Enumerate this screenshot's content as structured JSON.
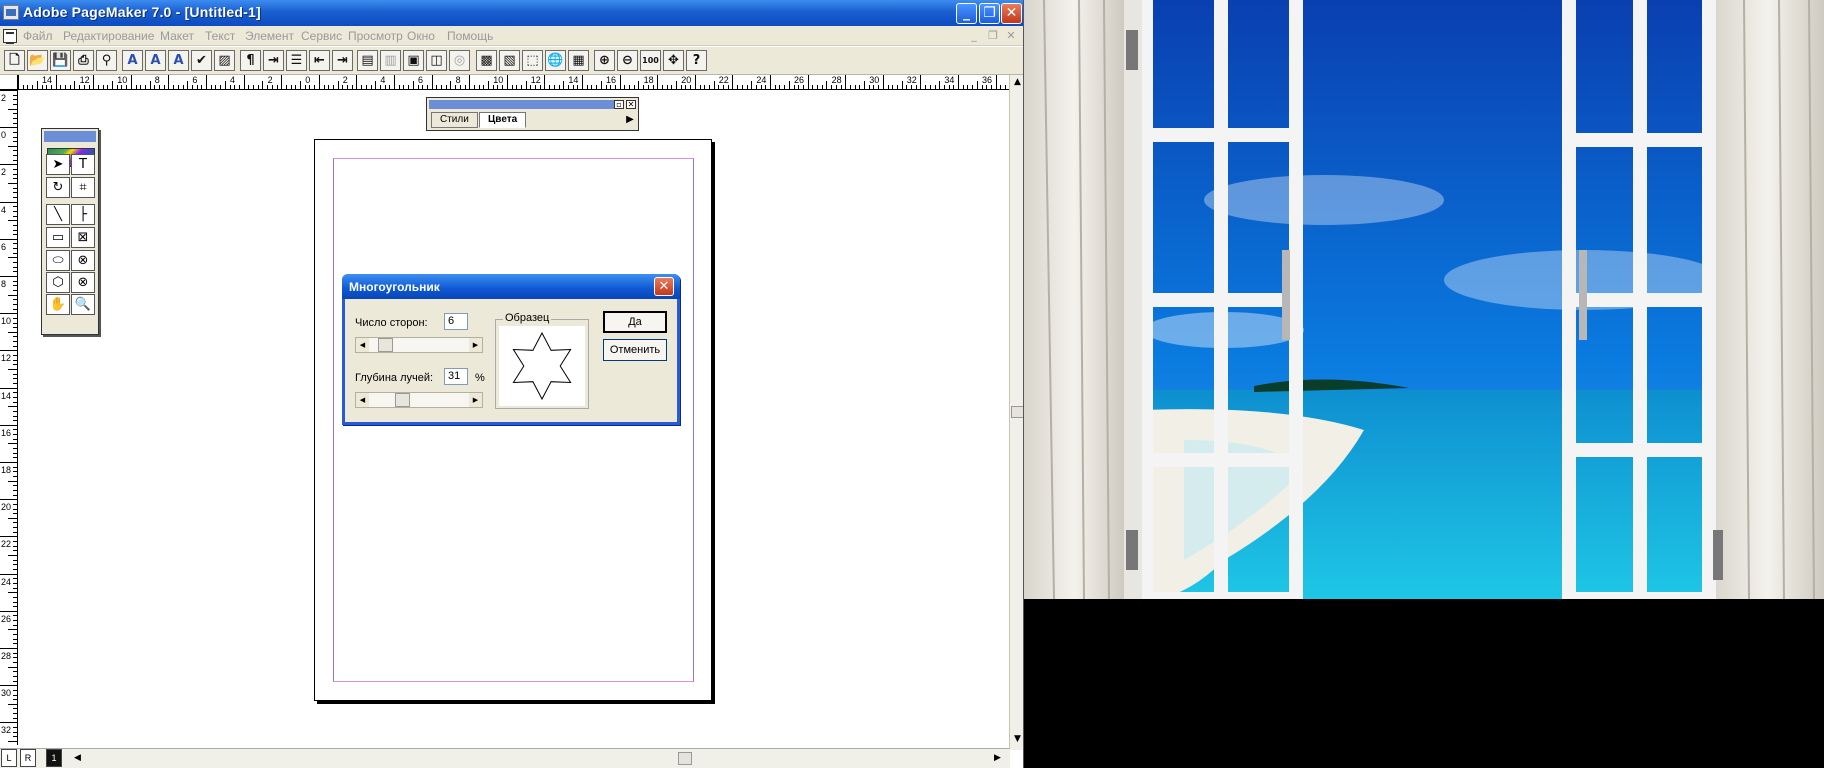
{
  "window": {
    "title": "Adobe PageMaker 7.0 - [Untitled-1]",
    "minimize": "_",
    "restore": "❐",
    "close": "✕"
  },
  "menu": {
    "items": [
      "Файл",
      "Редактирование",
      "Макет",
      "Текст",
      "Элемент",
      "Сервис",
      "Просмотр",
      "Окно",
      "Помощь"
    ],
    "doc_minimize": "_",
    "doc_restore": "❐",
    "doc_close": "✕"
  },
  "toolbar": {
    "buttons": [
      {
        "icon": "new-document-icon",
        "glyph": "🗋"
      },
      {
        "icon": "open-folder-icon",
        "glyph": "📂"
      },
      {
        "icon": "save-icon",
        "glyph": "💾"
      },
      {
        "icon": "print-icon",
        "glyph": "⎙"
      },
      {
        "icon": "find-icon",
        "glyph": "⚲"
      },
      {
        "icon": "character-format-icon",
        "glyph": "A"
      },
      {
        "icon": "font-size-up-icon",
        "glyph": "A"
      },
      {
        "icon": "font-size-down-icon",
        "glyph": "A"
      },
      {
        "icon": "spell-check-icon",
        "glyph": "✔"
      },
      {
        "icon": "fill-icon",
        "glyph": "▨"
      },
      {
        "icon": "paragraph-icon",
        "glyph": "¶"
      },
      {
        "icon": "indents-icon",
        "glyph": "⇥"
      },
      {
        "icon": "bullets-icon",
        "glyph": "☰"
      },
      {
        "icon": "decrease-indent-icon",
        "glyph": "⇤"
      },
      {
        "icon": "increase-indent-icon",
        "glyph": "⇥"
      },
      {
        "icon": "styles-icon",
        "glyph": "▤"
      },
      {
        "icon": "colors-icon",
        "glyph": "▥"
      },
      {
        "icon": "frame-icon",
        "glyph": "▣"
      },
      {
        "icon": "text-wrap-icon",
        "glyph": "◫"
      },
      {
        "icon": "group-icon",
        "glyph": "◎"
      },
      {
        "icon": "place-image-icon",
        "glyph": "▩"
      },
      {
        "icon": "image-edit-icon",
        "glyph": "▧"
      },
      {
        "icon": "export-icon",
        "glyph": "⬚"
      },
      {
        "icon": "globe-icon",
        "glyph": "🌐"
      },
      {
        "icon": "pdf-icon",
        "glyph": "▦"
      },
      {
        "icon": "zoom-in-icon",
        "glyph": "⊕"
      },
      {
        "icon": "zoom-out-icon",
        "glyph": "⊖"
      },
      {
        "icon": "actual-size-icon",
        "glyph": "100"
      },
      {
        "icon": "fit-window-icon",
        "glyph": "✥"
      },
      {
        "icon": "help-icon",
        "glyph": "?"
      }
    ]
  },
  "rulers": {
    "horizontal_labels": [
      "14",
      "12",
      "10",
      "8",
      "6",
      "4",
      "2",
      "0",
      "2",
      "4",
      "6",
      "8",
      "10",
      "12",
      "14",
      "16",
      "18",
      "20",
      "22",
      "24",
      "26",
      "28",
      "30",
      "32",
      "34",
      "36"
    ],
    "vertical_labels": [
      "2",
      "0",
      "2",
      "4",
      "6",
      "8",
      "10",
      "12",
      "14",
      "16",
      "18",
      "20",
      "22",
      "24",
      "26",
      "28",
      "30",
      "32"
    ]
  },
  "palette": {
    "tabs": [
      "Стили",
      "Цвета"
    ],
    "active_tab": "Цвета",
    "restore": "▫",
    "close": "✕",
    "menu_arrow": "▶"
  },
  "toolbox": {
    "tools": [
      {
        "icon": "pointer-icon",
        "glyph": "➤"
      },
      {
        "icon": "text-tool-icon",
        "glyph": "T"
      },
      {
        "icon": "rotate-icon",
        "glyph": "↻"
      },
      {
        "icon": "crop-icon",
        "glyph": "⌗"
      },
      {
        "icon": "line-icon",
        "glyph": "╲"
      },
      {
        "icon": "constrained-line-icon",
        "glyph": "├"
      },
      {
        "icon": "rectangle-icon",
        "glyph": "▭"
      },
      {
        "icon": "rectangle-frame-icon",
        "glyph": "⊠"
      },
      {
        "icon": "ellipse-icon",
        "glyph": "⬭"
      },
      {
        "icon": "ellipse-frame-icon",
        "glyph": "⊗"
      },
      {
        "icon": "polygon-icon",
        "glyph": "⬡"
      },
      {
        "icon": "polygon-frame-icon",
        "glyph": "⊗"
      },
      {
        "icon": "hand-icon",
        "glyph": "✋"
      },
      {
        "icon": "zoom-icon",
        "glyph": "🔍"
      }
    ]
  },
  "dialog": {
    "title": "Многоугольник",
    "sides_label": "Число сторон:",
    "sides_value": "6",
    "sides_slider_level": 0.1,
    "depth_label": "Глубина лучей:",
    "depth_value": "31",
    "depth_unit": "%",
    "depth_slider_level": 0.31,
    "preview_label": "Образец",
    "ok_label": "Да",
    "cancel_label": "Отменить",
    "close": "✕"
  },
  "statusbar": {
    "master_left": "L",
    "master_right": "R",
    "current_page": "1",
    "left_arrow": "◀",
    "right_arrow": "▶"
  },
  "scrollbar": {
    "up_arrow": "▲",
    "down_arrow": "▼"
  },
  "colors": {
    "titlebar": "#1a5fcf",
    "menu_bg": "#ece9d8",
    "margin_guide": "#e08fe0",
    "sky": "#0a7be0",
    "sea": "#1fc7e6"
  }
}
